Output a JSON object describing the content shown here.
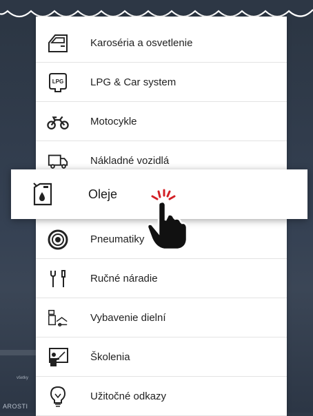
{
  "background": {
    "footer_text": "AROSTI",
    "small_text": "všetky"
  },
  "menu": {
    "items": [
      {
        "label": "Karoséria a osvetlenie",
        "icon": "car-door-icon"
      },
      {
        "label": "LPG & Car system",
        "icon": "lpg-icon"
      },
      {
        "label": "Motocykle",
        "icon": "motorcycle-icon"
      },
      {
        "label": "Nákladné vozidlá",
        "icon": "truck-icon"
      },
      {
        "label": "Pneumatiky",
        "icon": "tire-icon"
      },
      {
        "label": "Ručné náradie",
        "icon": "wrench-icon"
      },
      {
        "label": "Vybavenie dielní",
        "icon": "workshop-equipment-icon"
      },
      {
        "label": "Školenia",
        "icon": "presentation-icon"
      },
      {
        "label": "Užitočné odkazy",
        "icon": "lightbulb-icon"
      }
    ],
    "highlighted": {
      "label": "Oleje",
      "icon": "oil-canister-icon"
    },
    "lpg_badge": "LPG"
  },
  "pointer": {
    "icon": "hand-pointer-icon",
    "burst_color": "#d32026"
  }
}
